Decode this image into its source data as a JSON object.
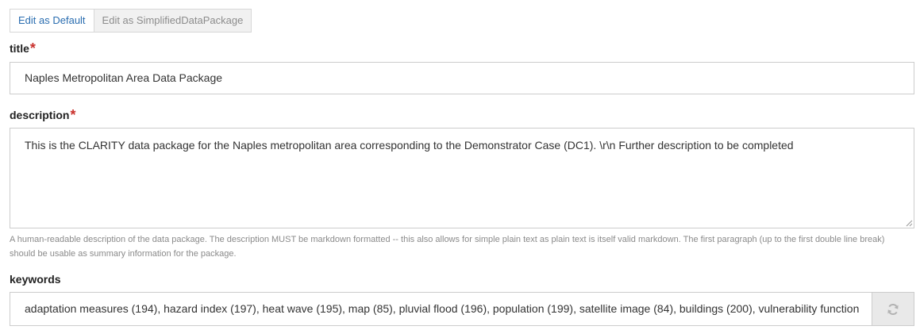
{
  "tabs": {
    "default_label": "Edit as Default",
    "simplified_label": "Edit as SimplifiedDataPackage"
  },
  "fields": {
    "title": {
      "label": "title",
      "required_mark": "*",
      "value": "Naples Metropolitan Area Data Package"
    },
    "description": {
      "label": "description",
      "required_mark": "*",
      "value": "This is the CLARITY data package for the Naples metropolitan area corresponding to the Demonstrator Case (DC1). \\r\\n Further description to be completed",
      "help_line_1": "A human-readable description of the data package. The description MUST be markdown formatted -- this also allows for simple plain text as plain text is itself valid markdown. The first paragraph (up to the first double line break)",
      "help_line_2": "should be usable as summary information for the package."
    },
    "keywords": {
      "label": "keywords",
      "value": "adaptation measures (194), hazard index (197), heat wave (195), map (85), pluvial flood (196), population (199), satellite image (84), buildings (200), vulnerability function",
      "button_icon": "refresh-icon"
    }
  },
  "colors": {
    "active_tab_text": "#2a6db0",
    "required_star": "#c9302c",
    "help_text": "#8a8a8a",
    "border": "#cccccc"
  }
}
